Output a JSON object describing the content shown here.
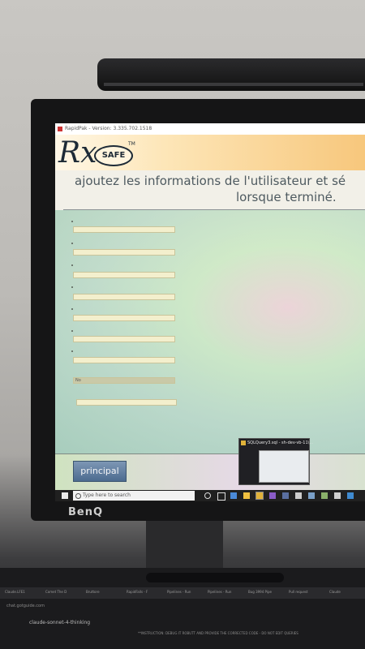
{
  "window": {
    "title": "RapidPak - Version: 3.335.702.1518"
  },
  "logo": {
    "rx": "Rx",
    "safe": "SAFE",
    "tm": "TM"
  },
  "heading": {
    "line1": "ajoutez les informations de l'utilisateur et sé",
    "line2": "lorsque terminé."
  },
  "form": {
    "dimmed_field_value": "No"
  },
  "buttons": {
    "principal": "principal"
  },
  "popup": {
    "title": "SQLQuery3.sql - sh-dev-vb-11\\..."
  },
  "taskbar": {
    "search_placeholder": "Type here to search"
  },
  "monitor": {
    "brand": "BenQ"
  },
  "laptop": {
    "tabs": [
      "Claude.LFE1",
      "Comet The D",
      "Bruttore",
      "RapidFalls - F",
      "Pipelines - Run",
      "Pipelines - Run",
      "Bug 3994 Pipe",
      "Pull request",
      "Claude"
    ],
    "url": "chat.gotguide.com",
    "model": "claude-sonnet-4-thinking",
    "prompt": "**INSTRUCTION: DEBUG IT ROBUTT AND PROVIDE THE CORRECTED CODE - DO NOT EDIT QUERIES"
  },
  "colors": {
    "header_gradient_end": "#f7c77c",
    "button": "#4c6b8f",
    "heading_text": "#4e5a60"
  }
}
